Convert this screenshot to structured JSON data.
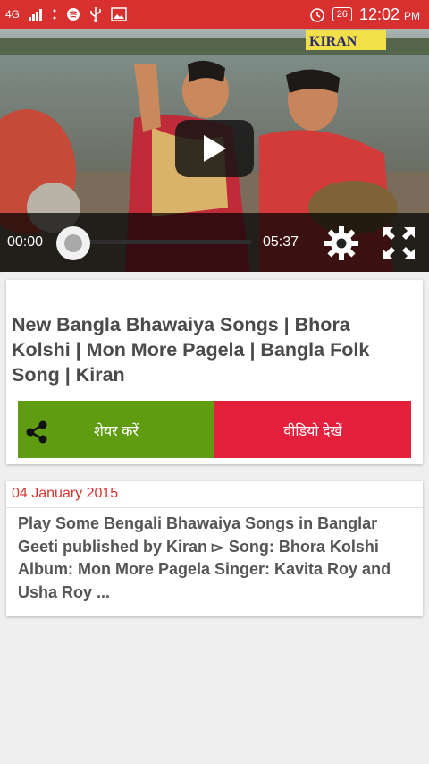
{
  "status_bar": {
    "network": "4G",
    "battery": "26",
    "time": "12:02",
    "ampm": "PM"
  },
  "video": {
    "watermark": "KIRAN",
    "current_time": "00:00",
    "duration": "05:37",
    "progress": 0
  },
  "title_card": {
    "title": "New Bangla Bhawaiya Songs | Bhora Kolshi | Mon More Pagela | Bangla Folk Song | Kiran",
    "share_label": "शेयर करें",
    "watch_label": "वीडियो देखें"
  },
  "description_card": {
    "date": "04 January 2015",
    "description": "Play Some Bengali Bhawaiya Songs in Banglar Geeti published by Kiran ▻ Song: Bhora Kolshi Album: Mon More Pagela Singer: Kavita Roy and Usha Roy ..."
  },
  "colors": {
    "status_bar": "#d8302f",
    "share": "#5f9c12",
    "watch": "#e4203d",
    "date": "#d9322f"
  }
}
